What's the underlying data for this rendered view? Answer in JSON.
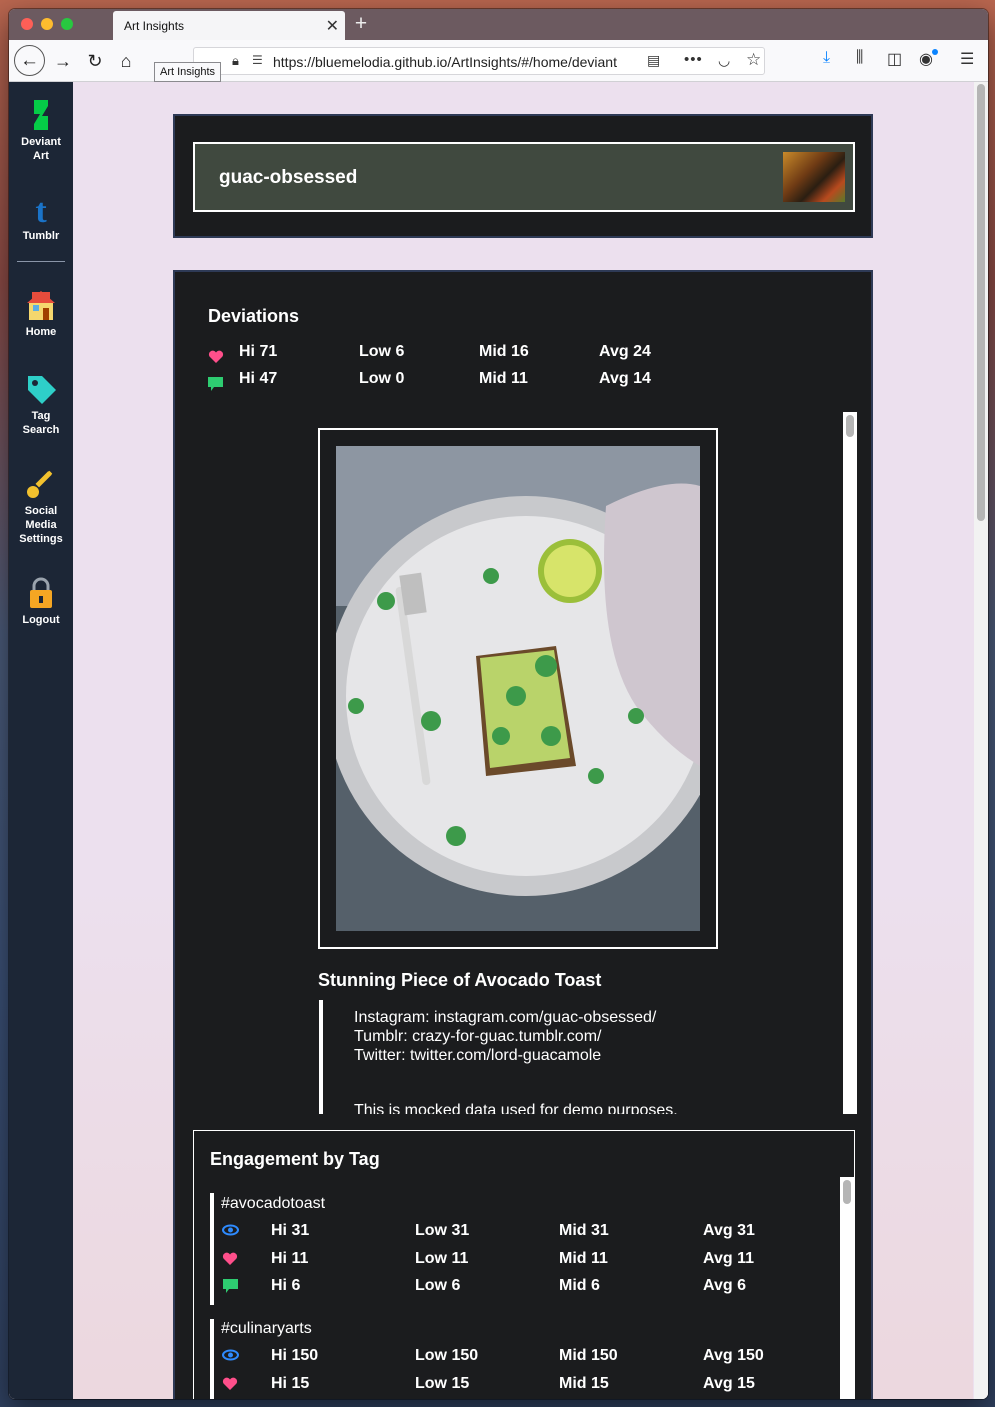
{
  "browser": {
    "tab_title": "Art Insights",
    "tab_close": "✕",
    "new_tab": "+",
    "tooltip": "Art Insights",
    "url": "https://bluemelodia.github.io/ArtInsights/#/home/deviant"
  },
  "sidebar": {
    "items": [
      {
        "label": "Deviant Art",
        "line1": "Deviant",
        "line2": "Art",
        "icon": "deviantart-icon",
        "color": "#05cc47"
      },
      {
        "label": "Tumblr",
        "icon": "tumblr-icon",
        "color": "#1a73c8"
      },
      {
        "label": "Home",
        "icon": "house-icon"
      },
      {
        "label": "Tag Search",
        "line1": "Tag",
        "line2": "Search",
        "icon": "tag-icon",
        "color": "#2ecfc8"
      },
      {
        "label": "Social Media Settings",
        "line1": "Social",
        "line2": "Media",
        "line3": "Settings",
        "icon": "key-icon",
        "color": "#f2c12e"
      },
      {
        "label": "Logout",
        "icon": "lock-icon",
        "color": "#f5a623"
      }
    ]
  },
  "header": {
    "username": "guac-obsessed"
  },
  "deviations": {
    "title": "Deviations",
    "favorites": {
      "hi": "Hi 71",
      "low": "Low 6",
      "mid": "Mid 16",
      "avg": "Avg 24"
    },
    "comments": {
      "hi": "Hi 47",
      "low": "Low 0",
      "mid": "Mid 11",
      "avg": "Avg 14"
    }
  },
  "deviation_item": {
    "title": "Stunning Piece of Avocado Toast",
    "description": [
      "Instagram: instagram.com/guac-obsessed/",
      "Tumblr: crazy-for-guac.tumblr.com/",
      "Twitter: twitter.com/lord-guacamole",
      "",
      "This is mocked data used for demo purposes."
    ]
  },
  "engagement": {
    "title": "Engagement by Tag",
    "tags": [
      {
        "name": "#avocadotoast",
        "views": {
          "hi": "Hi 31",
          "low": "Low 31",
          "mid": "Mid 31",
          "avg": "Avg 31"
        },
        "favorites": {
          "hi": "Hi 11",
          "low": "Low 11",
          "mid": "Mid 11",
          "avg": "Avg 11"
        },
        "comments": {
          "hi": "Hi 6",
          "low": "Low 6",
          "mid": "Mid 6",
          "avg": "Avg 6"
        }
      },
      {
        "name": "#culinaryarts",
        "views": {
          "hi": "Hi 150",
          "low": "Low 150",
          "mid": "Mid 150",
          "avg": "Avg 150"
        },
        "favorites": {
          "hi": "Hi 15",
          "low": "Low 15",
          "mid": "Mid 15",
          "avg": "Avg 15"
        }
      }
    ]
  },
  "colors": {
    "heart": "#ff4f8b",
    "comment": "#2ecc71",
    "eye": "#2e8bff",
    "card": "#1b1c1e",
    "sidebar": "#1c2636"
  }
}
